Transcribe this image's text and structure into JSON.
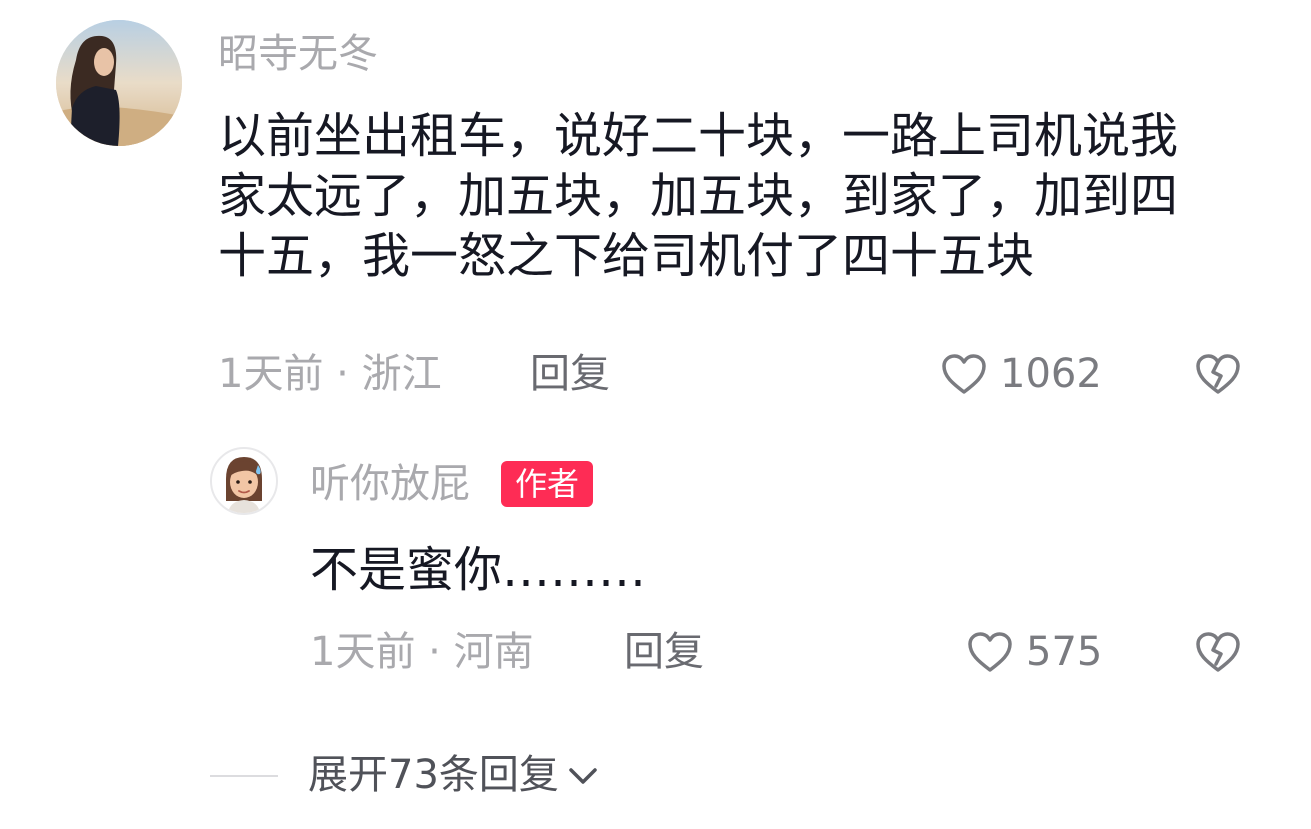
{
  "main_comment": {
    "username": "昭寺无冬",
    "text_lines": [
      "以前坐出租车，说好二十块，一路上司机说我",
      "家太远了，加五块，加五块，到家了，加到四",
      "十五，我一怒之下给司机付了四十五块"
    ],
    "meta": "1天前 · 浙江",
    "reply_label": "回复",
    "likes": "1062",
    "avatar_icon": "woman-photo-avatar",
    "like_icon": "heart-outline-icon",
    "dislike_icon": "broken-heart-icon"
  },
  "reply_comment": {
    "username": "听你放屁",
    "author_badge": "作者",
    "text": "不是蜜你………",
    "meta": "1天前 · 河南",
    "reply_label": "回复",
    "likes": "575",
    "avatar_icon": "memoji-sweat-avatar"
  },
  "expand": {
    "label": "展开73条回复",
    "icon": "chevron-down-icon"
  },
  "colors": {
    "text_primary": "#161823",
    "text_secondary": "#a9a9ad",
    "badge": "#fe2c55"
  }
}
